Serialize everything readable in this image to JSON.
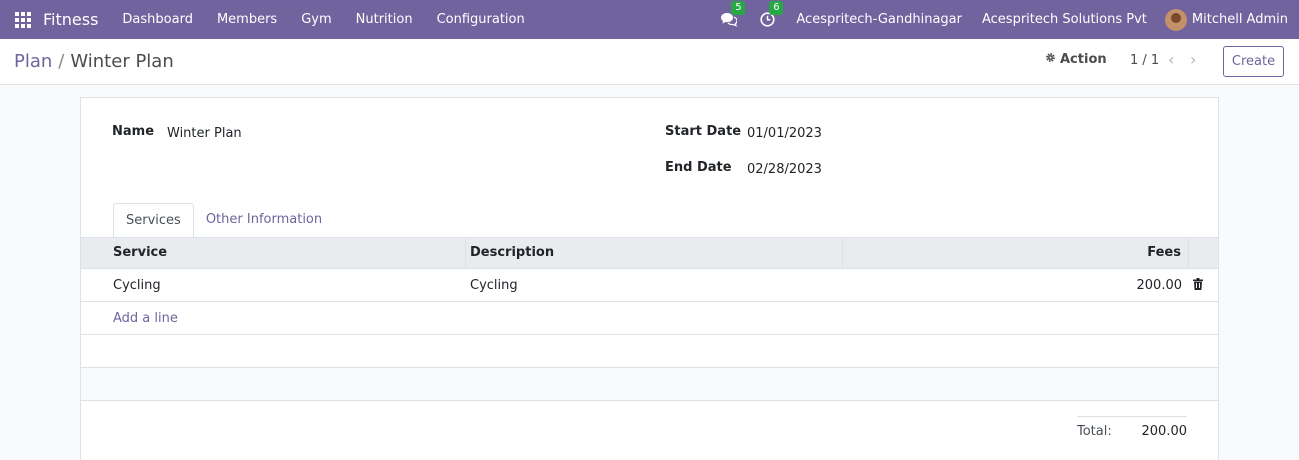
{
  "navbar": {
    "brand": "Fitness",
    "menu": [
      "Dashboard",
      "Members",
      "Gym",
      "Nutrition",
      "Configuration"
    ],
    "messages_count": "5",
    "activities_count": "6",
    "company_branch": "Acespritech-Gandhinagar",
    "company_name": "Acespritech Solutions Pvt",
    "user_name": "Mitchell Admin"
  },
  "control_panel": {
    "breadcrumb_parent": "Plan",
    "breadcrumb_separator": "/",
    "breadcrumb_current": "Winter Plan",
    "action_label": "Action",
    "pager_value": "1 / 1",
    "create_label": "Create"
  },
  "form": {
    "name_label": "Name",
    "name_value": "Winter Plan",
    "start_date_label": "Start Date",
    "start_date_value": "01/01/2023",
    "end_date_label": "End Date",
    "end_date_value": "02/28/2023",
    "tabs": [
      "Services",
      "Other Information"
    ],
    "table": {
      "headers": [
        "Service",
        "Description",
        "Fees"
      ],
      "rows": [
        {
          "service": "Cycling",
          "description": "Cycling",
          "fees": "200.00"
        }
      ],
      "add_line_label": "Add a line"
    },
    "total_label": "Total:",
    "total_value": "200.00"
  }
}
